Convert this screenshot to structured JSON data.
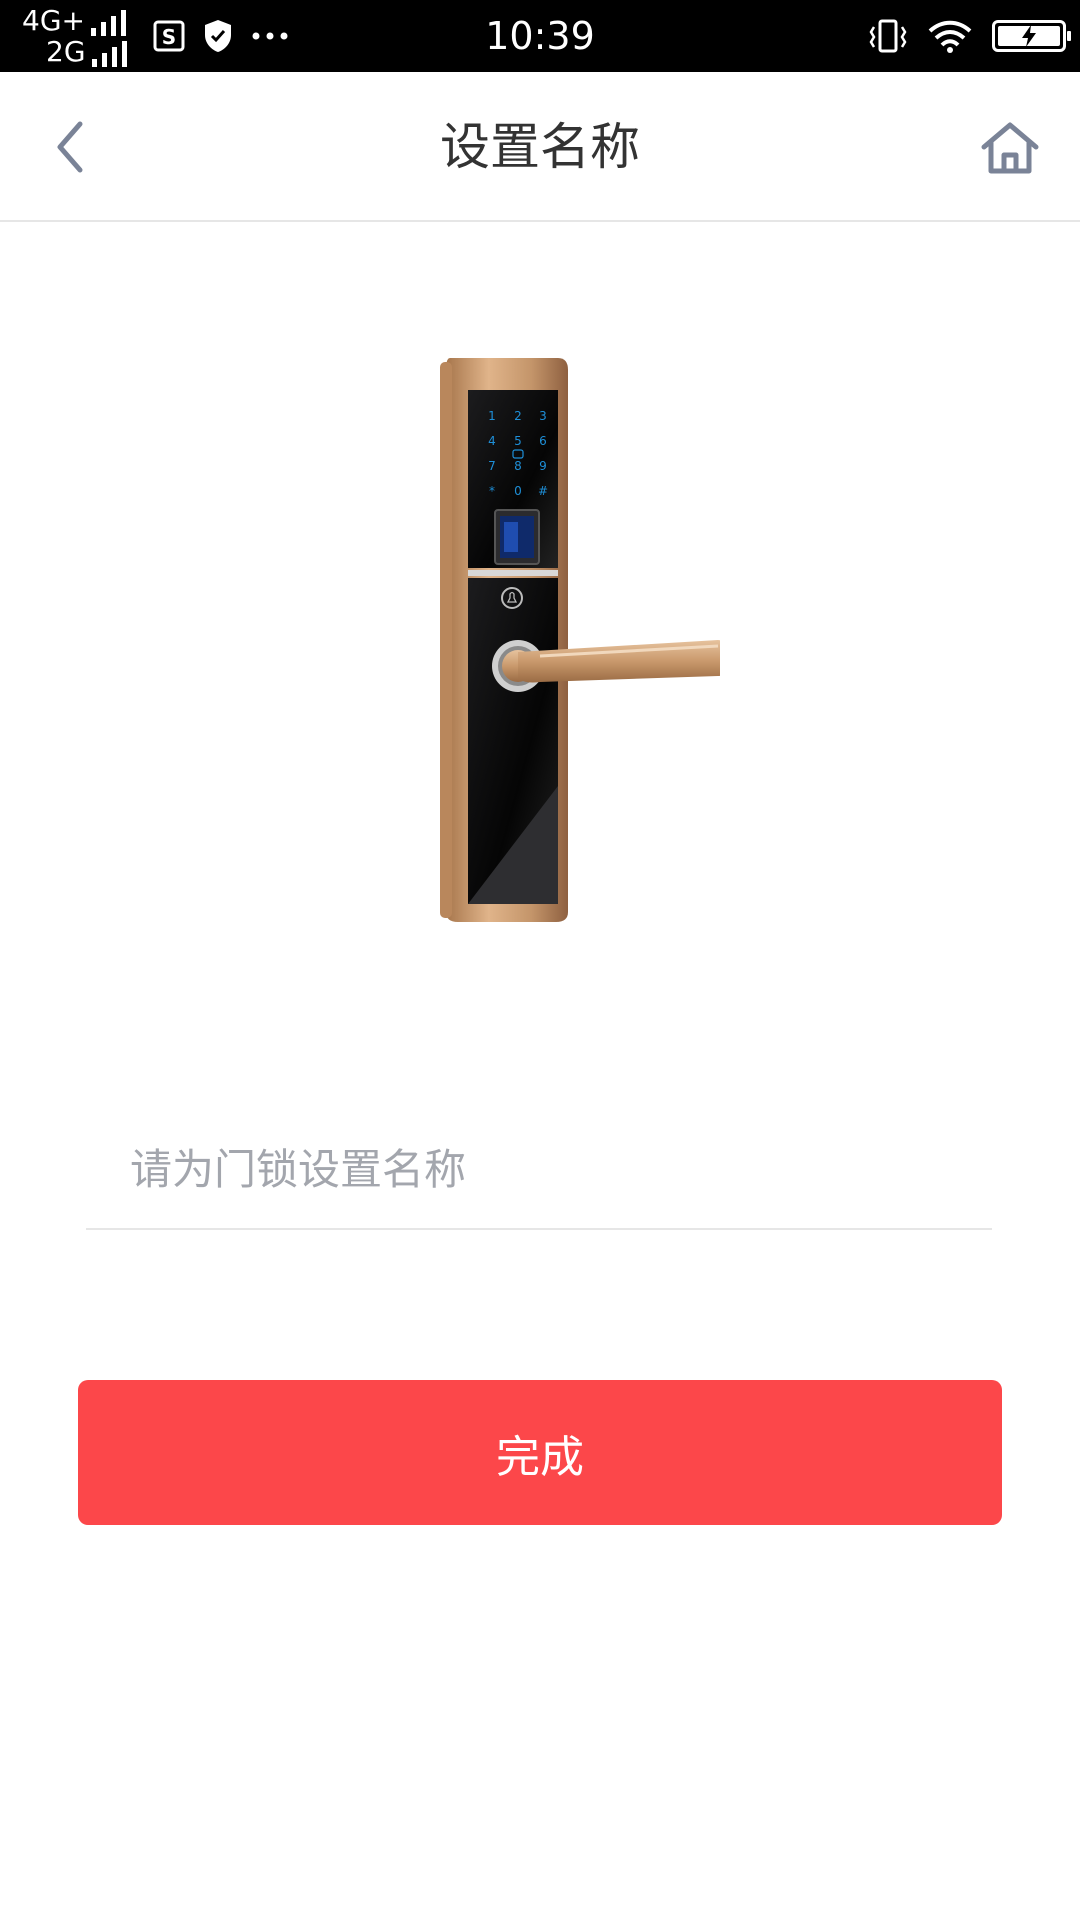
{
  "status_bar": {
    "network_1": "4G+",
    "network_2": "2G",
    "time": "10:39",
    "icons": [
      "sim-s-icon",
      "shield-icon",
      "more-dots-icon",
      "vibrate-icon",
      "wifi-icon",
      "battery-charging-icon"
    ]
  },
  "header": {
    "title": "设置名称",
    "back_icon": "chevron-left-icon",
    "home_icon": "home-icon"
  },
  "main": {
    "image": "smart-door-lock",
    "name_input": {
      "value": "",
      "placeholder": "请为门锁设置名称"
    },
    "done_button": "完成"
  },
  "colors": {
    "accent": "#fc474a",
    "icon_gray": "#7a8397",
    "title": "#333333",
    "placeholder": "#a3a6ad",
    "divider": "#e6e6e6"
  }
}
